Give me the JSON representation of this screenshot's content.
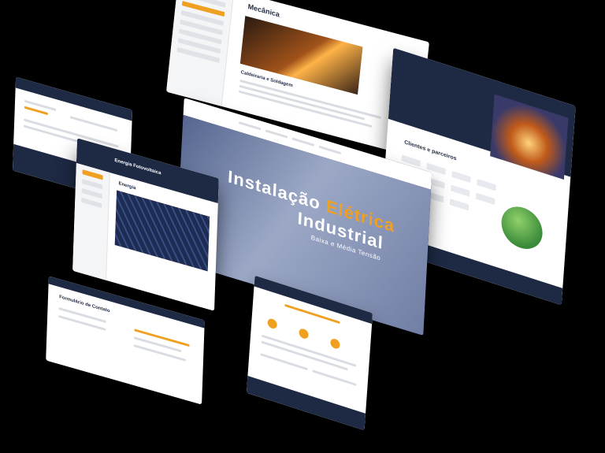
{
  "colors": {
    "accent": "#f0a020",
    "navy": "#1e2a44",
    "background": "#000000"
  },
  "mecanica": {
    "title": "Mecânica",
    "section": "Caldeiraria e Soldagem"
  },
  "energia": {
    "title": "Energia Fotovoltaica",
    "card_title": "Energia"
  },
  "hero": {
    "title_part1": "Instalação ",
    "title_accent": "Elétrica",
    "title_part2": "Industrial",
    "subtitle": "Baixa e Média Tensão"
  },
  "clientes": {
    "title": "Clientes e parceiros"
  },
  "contato": {
    "title": "Formulário de Contato"
  }
}
